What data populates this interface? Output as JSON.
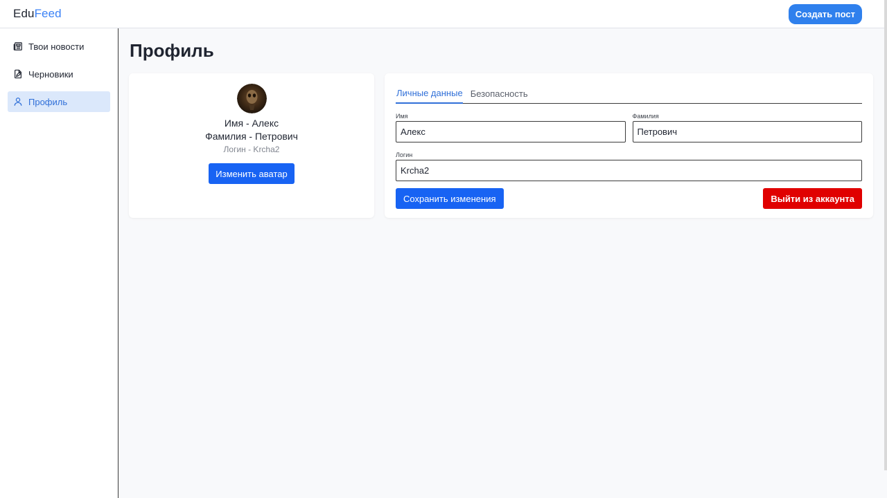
{
  "header": {
    "logo_part1": "Edu",
    "logo_part2": "Feed",
    "create_post_label": "Создать пост"
  },
  "sidebar": {
    "items": [
      {
        "label": "Твои новости",
        "icon": "newspaper-icon",
        "active": false
      },
      {
        "label": "Черновики",
        "icon": "draft-icon",
        "active": false
      },
      {
        "label": "Профиль",
        "icon": "user-icon",
        "active": true
      }
    ]
  },
  "main": {
    "title": "Профиль",
    "profile_card": {
      "name_line": "Имя - Алекс",
      "surname_line": "Фамилия - Петрович",
      "login_line": "Логин - Krcha2",
      "change_avatar_label": "Изменить аватар"
    },
    "settings": {
      "tabs": [
        "Личные данные",
        "Безопасность"
      ],
      "active_tab": "Личные данные",
      "first_name": {
        "label": "Имя",
        "value": "Алекс"
      },
      "last_name": {
        "label": "Фамилия",
        "value": "Петрович"
      },
      "login": {
        "label": "Логин",
        "value": "Krcha2"
      },
      "save_label": "Сохранить изменения",
      "logout_label": "Выйти из аккаунта"
    }
  },
  "colors": {
    "accent": "#2f80ed",
    "primary_button": "#1863f3",
    "danger_button": "#e00000",
    "active_nav_bg": "#dbe8fb",
    "background": "#f8f9fb"
  }
}
